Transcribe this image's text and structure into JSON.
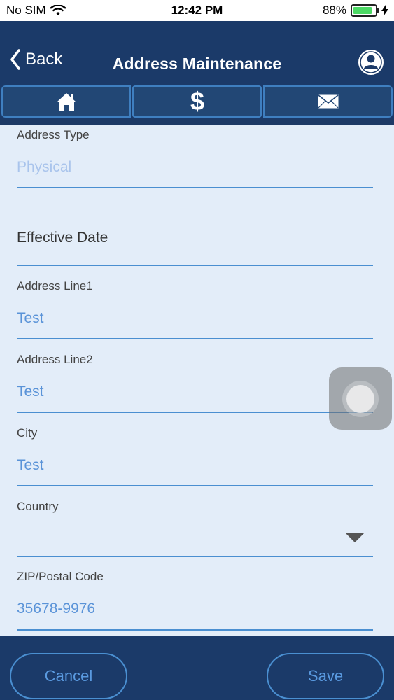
{
  "status": {
    "carrier": "No SIM",
    "time": "12:42 PM",
    "battery": "88%",
    "battery_level": 0.88
  },
  "nav": {
    "back_label": "Back",
    "title": "Address Maintenance"
  },
  "tabs": [
    {
      "icon": "home-icon"
    },
    {
      "icon": "dollar-icon"
    },
    {
      "icon": "mail-icon"
    }
  ],
  "form": {
    "address_type": {
      "label": "Address Type",
      "placeholder": "Physical"
    },
    "effective_date": {
      "label": "Effective Date"
    },
    "address_line1": {
      "label": "Address Line1",
      "value": "Test"
    },
    "address_line2": {
      "label": "Address Line2",
      "value": "Test"
    },
    "city": {
      "label": "City",
      "value": "Test"
    },
    "country": {
      "label": "Country",
      "value": ""
    },
    "zip": {
      "label": "ZIP/Postal Code",
      "value": "35678-9976"
    }
  },
  "actions": {
    "cancel_label": "Cancel",
    "save_label": "Save"
  },
  "colors": {
    "nav_bg": "#1b3a69",
    "form_bg": "#e3edf9",
    "accent": "#4a8fd1",
    "value_text": "#5a93d8"
  }
}
